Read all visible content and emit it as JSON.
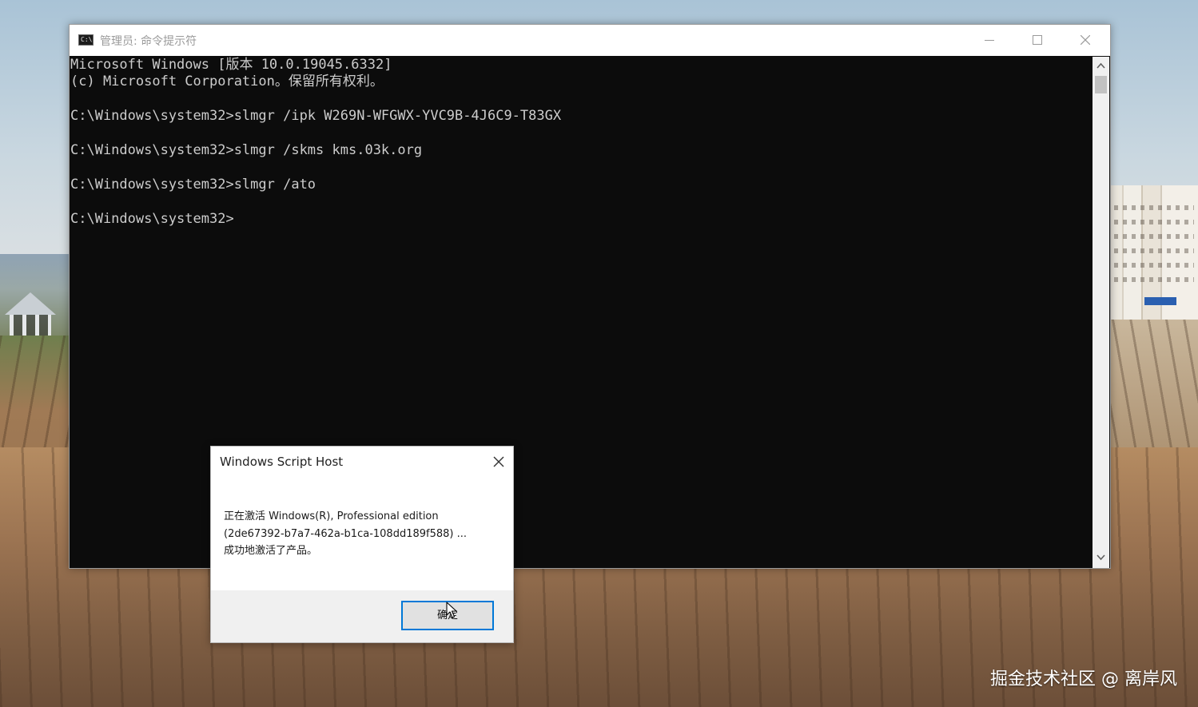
{
  "console": {
    "window_title": "管理员: 命令提示符",
    "icon_glyph": "C:\\",
    "lines": [
      "Microsoft Windows [版本 10.0.19045.6332]",
      "(c) Microsoft Corporation。保留所有权利。",
      "",
      "C:\\Windows\\system32>slmgr /ipk W269N-WFGWX-YVC9B-4J6C9-T83GX",
      "",
      "C:\\Windows\\system32>slmgr /skms kms.03k.org",
      "",
      "C:\\Windows\\system32>slmgr /ato",
      "",
      "C:\\Windows\\system32>"
    ]
  },
  "dialog": {
    "title": "Windows Script Host",
    "message_lines": [
      "正在激活 Windows(R), Professional edition",
      "(2de67392-b7a7-462a-b1ca-108dd189f588) ...",
      "成功地激活了产品。"
    ],
    "ok_label": "确定"
  },
  "watermark": {
    "text": "掘金技术社区 @ 离岸风"
  },
  "icons": {
    "minimize": "minimize-icon",
    "maximize": "maximize-icon",
    "close": "close-icon",
    "cursor": "mouse-cursor-icon"
  },
  "colors": {
    "console_bg": "#0c0c0c",
    "console_text": "#cccccc",
    "dialog_accent": "#0078d7"
  }
}
